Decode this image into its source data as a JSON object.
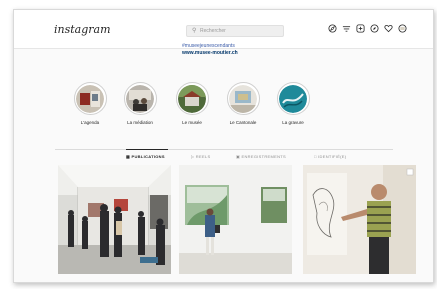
{
  "header": {
    "logo_text": "instagram",
    "search_placeholder": "Rechercher",
    "nav_icons": [
      "compass-icon",
      "filter-icon",
      "add-post-icon",
      "explore-icon",
      "heart-icon",
      "profile-icon"
    ]
  },
  "bio": {
    "line1": "#museejeunescendants",
    "link": "www.musee-moutier.ch"
  },
  "highlights": [
    {
      "label": "L'agenda"
    },
    {
      "label": "La médiation"
    },
    {
      "label": "Le musée"
    },
    {
      "label": "Le Cantonale"
    },
    {
      "label": "La gravure"
    }
  ],
  "tabs": [
    {
      "label": "PUBLICATIONS",
      "active": true
    },
    {
      "label": "REELS",
      "active": false
    },
    {
      "label": "ENREGISTREMENTS",
      "active": false
    },
    {
      "label": "IDENTIFIÉ(E)",
      "active": false
    }
  ],
  "colors": {
    "accent_link": "#003569",
    "text": "#262626",
    "muted": "#8e8e8e"
  }
}
